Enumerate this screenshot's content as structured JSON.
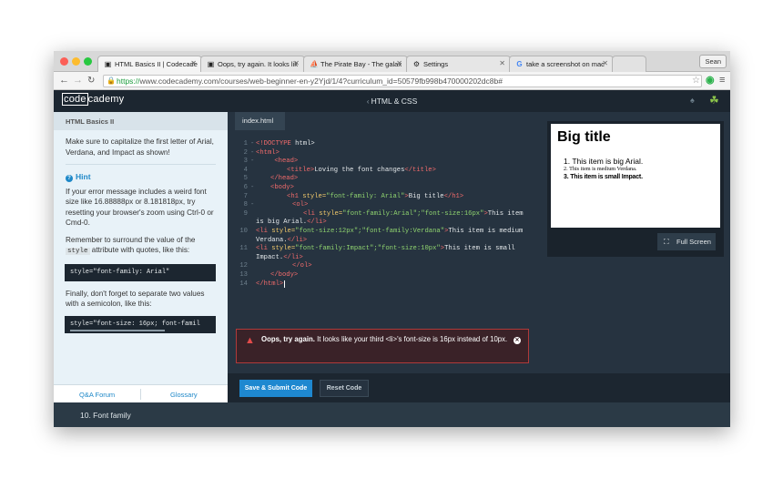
{
  "browser": {
    "tabs": [
      {
        "label": "HTML Basics II | Codecade",
        "icon": "codecademy-favicon-icon",
        "active": true
      },
      {
        "label": "Oops, try again. It looks lik",
        "icon": "codecademy-favicon-icon",
        "active": false
      },
      {
        "label": "The Pirate Bay - The galax",
        "icon": "pirate-ship-icon",
        "active": false
      },
      {
        "label": "Settings",
        "icon": "gear-icon",
        "active": false
      },
      {
        "label": "take a screenshot on mac",
        "icon": "google-g-icon",
        "active": false
      }
    ],
    "profile": "Sean",
    "url_scheme": "https://",
    "url_rest": "www.codecademy.com/courses/web-beginner-en-y2Yjd/1/4?curriculum_id=50579fb998b470000202dc8b#"
  },
  "header": {
    "logo_part1": "code",
    "logo_part2": "cademy",
    "course": "HTML & CSS"
  },
  "instructions": {
    "title": "HTML Basics II",
    "intro": "Make sure to capitalize the first letter of Arial, Verdana, and Impact as shown!",
    "hint_label": "Hint",
    "hint_p1": "If your error message includes a weird font size like 16.88888px or 8.181818px, try resetting your browser's zoom using Ctrl-0 or Cmd-0.",
    "hint_p2_a": "Remember to surround the value of the ",
    "hint_p2_code": "style",
    "hint_p2_b": " attribute with quotes, like this:",
    "code1": "style=\"font-family: Arial\"",
    "hint_p3": "Finally, don't forget to separate two values with a semicolon, like this:",
    "code2": "style=\"font-size: 16px; font-famil",
    "qa": "Q&A Forum",
    "glossary": "Glossary"
  },
  "editor": {
    "file_tab": "index.html",
    "line_numbers": [
      "1",
      "2",
      "3",
      "4",
      "5",
      "6",
      "7",
      "8",
      "9",
      "",
      "10",
      "",
      "11",
      "",
      "12",
      "13",
      "14"
    ],
    "lines": {
      "l1_doctype": "<!DOCTYPE",
      "l1_rest": " html>",
      "l2": "<html>",
      "l3": "<head>",
      "l4_open": "<title>",
      "l4_text": "Loving the font changes",
      "l4_close": "</title>",
      "l5": "</head>",
      "l6": "<body>",
      "l7_tag": "<h1",
      "l7_attr": " style=",
      "l7_val": "\"font-family: Arial\"",
      "l7_end": ">",
      "l7_text": "Big title",
      "l7_close": "</h1>",
      "l8": "<ol>",
      "l9_tag": "<li",
      "l9_attr": " style=",
      "l9_val": "\"font-family:Arial\";\"font-size:16px\"",
      "l9_end": ">",
      "l9_text": "This item",
      "l9b_text": "is big Arial.",
      "l9b_close": "</li>",
      "l10_tag": "<li",
      "l10_attr": " style=",
      "l10_val": "\"font-size:12px\";\"font-family:Verdana\"",
      "l10_end": ">",
      "l10_text": "This item is medium",
      "l10b_text": "Verdana.",
      "l10b_close": "</li>",
      "l11_tag": "<li",
      "l11_attr": " style=",
      "l11_val": "\"font-family:Impact\";\"font-size:10px\"",
      "l11_end": ">",
      "l11_text": "This item is small",
      "l11b_text": "Impact.",
      "l11b_close": "</li>",
      "l12": "</ol>",
      "l13": "</body>",
      "l14": "</html>"
    }
  },
  "preview": {
    "title": "Big title",
    "items": [
      {
        "num": "1.",
        "text": "This item is big Arial."
      },
      {
        "num": "2.",
        "text": "This item is medium Verdana."
      },
      {
        "num": "3.",
        "text": "This item is small Impact."
      }
    ],
    "fullscreen": "Full Screen"
  },
  "error": {
    "strong": "Oops, try again.",
    "message": " It looks like your third <li>'s font-size is 16px instead of 10px."
  },
  "actions": {
    "submit": "Save & Submit Code",
    "reset": "Reset Code"
  },
  "footer": {
    "lesson": "10. Font family"
  }
}
